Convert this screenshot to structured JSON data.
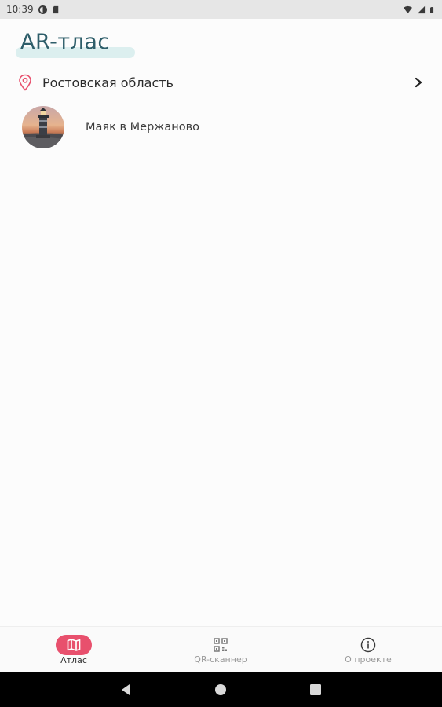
{
  "status_bar": {
    "time": "10:39",
    "left_icons": [
      "vpn-icon",
      "sd-card-icon"
    ],
    "right_icons": [
      "wifi-icon",
      "signal-icon",
      "battery-icon"
    ]
  },
  "app": {
    "title": "AR-тлас",
    "title_color": "#2e5e6a",
    "accent_color": "#e8506d"
  },
  "region": {
    "label": "Ростовская область",
    "icon": "map-pin-icon",
    "chevron": "chevron-right-icon"
  },
  "places": [
    {
      "name": "Маяк в Мержаново",
      "icon": "lighthouse-photo"
    }
  ],
  "bottom_nav": {
    "items": [
      {
        "label": "Атлас",
        "icon": "map-icon",
        "active": true
      },
      {
        "label": "QR-сканнер",
        "icon": "qr-icon",
        "active": false
      },
      {
        "label": "О проекте",
        "icon": "info-icon",
        "active": false
      }
    ]
  },
  "system_nav": {
    "buttons": [
      "back-icon",
      "home-icon",
      "recents-icon"
    ]
  }
}
